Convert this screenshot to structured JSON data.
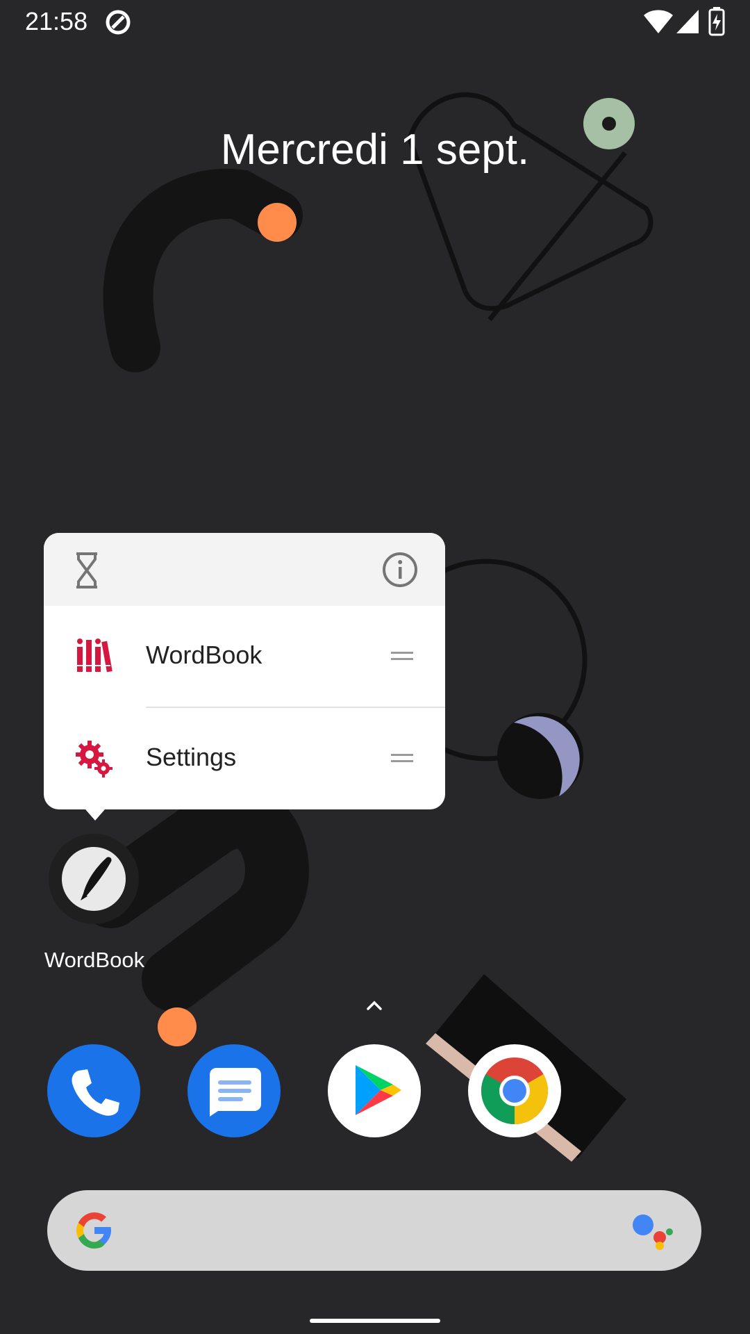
{
  "status_bar": {
    "time": "21:58",
    "icons": [
      "sync-icon",
      "wifi-icon",
      "signal-icon",
      "battery-charging-icon"
    ]
  },
  "date_widget": {
    "text": "Mercredi 1 sept."
  },
  "shortcut_popup": {
    "header_icons": [
      "hourglass-icon",
      "info-icon"
    ],
    "items": [
      {
        "label": "WordBook",
        "icon": "books-icon"
      },
      {
        "label": "Settings",
        "icon": "gears-icon"
      }
    ],
    "accent_color": "#d6173f"
  },
  "home_app": {
    "label": "WordBook",
    "icon": "wordbook-pen-icon"
  },
  "dock": {
    "apps": [
      {
        "name": "Phone",
        "icon": "phone-icon",
        "color": "#1a73e8"
      },
      {
        "name": "Messages",
        "icon": "messages-icon",
        "color": "#1a73e8"
      },
      {
        "name": "Play Store",
        "icon": "play-store-icon",
        "color": "#ffffff"
      },
      {
        "name": "Chrome",
        "icon": "chrome-icon",
        "color": "#ffffff"
      }
    ]
  },
  "search_bar": {
    "icons": [
      "google-g-icon",
      "assistant-icon"
    ]
  }
}
